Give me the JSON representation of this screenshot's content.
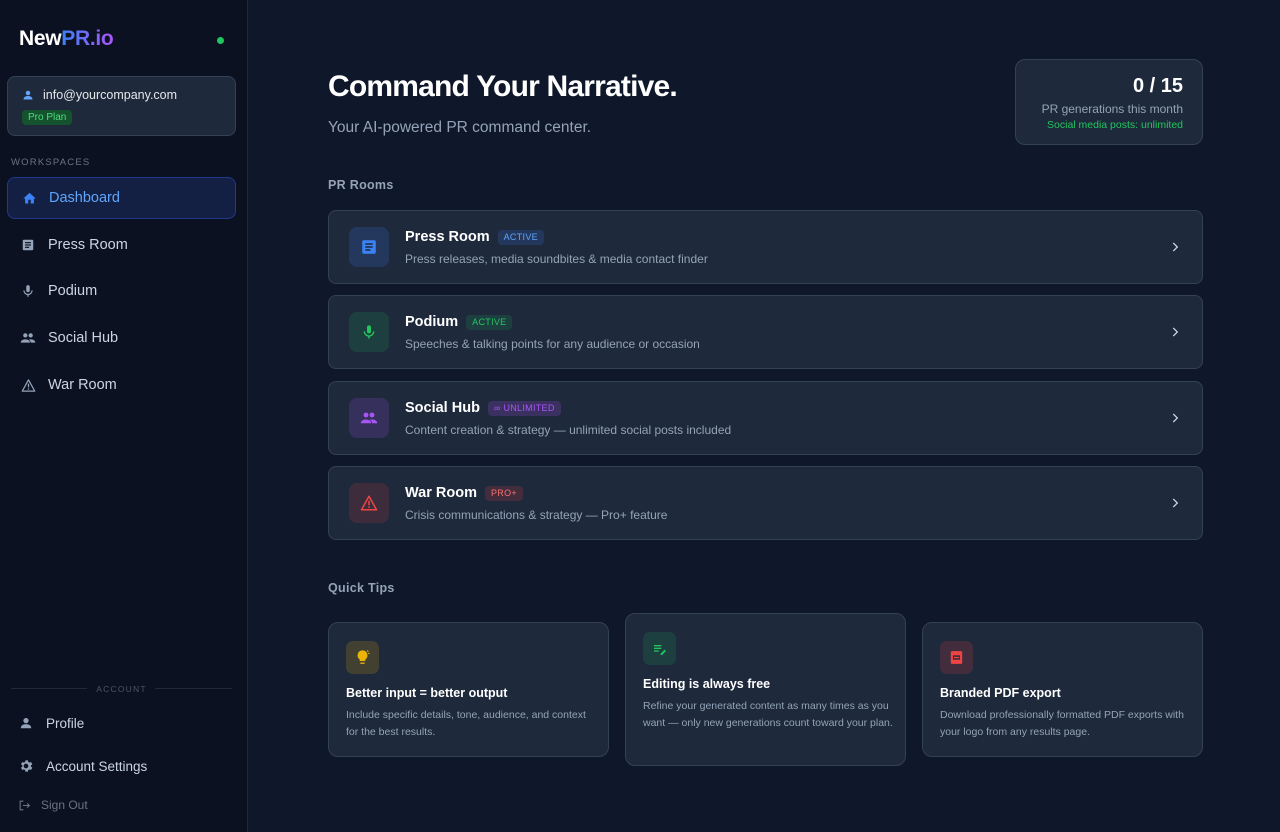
{
  "brand": {
    "part1": "New",
    "part2": "PR.io"
  },
  "user": {
    "email": "info@yourcompany.com",
    "plan": "Pro Plan"
  },
  "sidebar": {
    "workspaces_label": "WORKSPACES",
    "items": [
      {
        "label": "Dashboard",
        "icon": "home-icon"
      },
      {
        "label": "Press Room",
        "icon": "article-icon"
      },
      {
        "label": "Podium",
        "icon": "mic-icon"
      },
      {
        "label": "Social Hub",
        "icon": "people-icon"
      },
      {
        "label": "War Room",
        "icon": "warning-icon"
      }
    ],
    "account_label": "ACCOUNT",
    "account_items": [
      {
        "label": "Profile",
        "icon": "person-icon"
      },
      {
        "label": "Account Settings",
        "icon": "gear-icon"
      },
      {
        "label": "Sign Out",
        "icon": "logout-icon"
      }
    ]
  },
  "header": {
    "title": "Command Your Narrative.",
    "subtitle": "Your AI-powered PR command center."
  },
  "usage": {
    "count": "0 / 15",
    "label": "PR generations this month",
    "social": "Social media posts: unlimited"
  },
  "rooms_label": "PR Rooms",
  "rooms": [
    {
      "title": "Press Room",
      "badge": "ACTIVE",
      "desc": "Press releases, media soundbites & media contact finder",
      "icon": "article-icon",
      "accent": "#3b82f6"
    },
    {
      "title": "Podium",
      "badge": "ACTIVE",
      "desc": "Speeches & talking points for any audience or occasion",
      "icon": "mic-icon",
      "accent": "#22c55e"
    },
    {
      "title": "Social Hub",
      "badge": "∞ UNLIMITED",
      "desc": "Content creation & strategy — unlimited social posts included",
      "icon": "people-icon",
      "accent": "#a855f7"
    },
    {
      "title": "War Room",
      "badge": "PRO+",
      "desc": "Crisis communications & strategy — Pro+ feature",
      "icon": "warning-icon",
      "accent": "#ef4444"
    }
  ],
  "tips_label": "Quick Tips",
  "tips": [
    {
      "title": "Better input = better output",
      "desc": "Include specific details, tone, audience, and context for the best results.",
      "icon": "lightbulb-icon"
    },
    {
      "title": "Editing is always free",
      "desc": "Refine your generated content as many times as you want — only new generations count toward your plan.",
      "icon": "edit-note-icon"
    },
    {
      "title": "Branded PDF export",
      "desc": "Download professionally formatted PDF exports with your logo from any results page.",
      "icon": "pdf-icon"
    }
  ],
  "colors": {
    "accent_blue": "#3b82f6",
    "status_green": "#22c55e",
    "background": "#0f172a",
    "card": "#1e293b"
  }
}
